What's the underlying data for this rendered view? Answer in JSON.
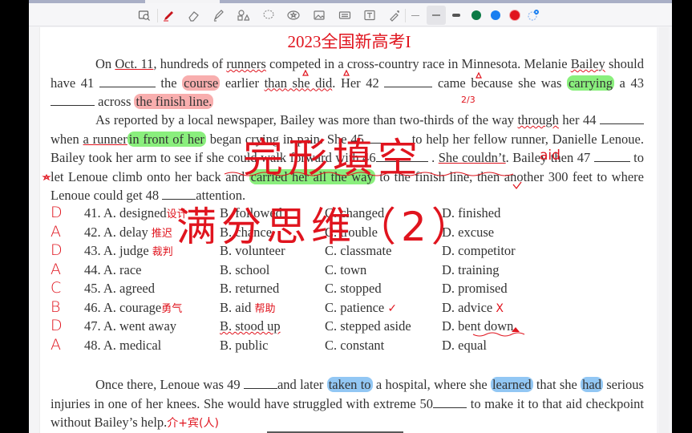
{
  "toolbar": {
    "tools": [
      {
        "name": "screen-capture-icon"
      },
      {
        "name": "pen-icon"
      },
      {
        "name": "eraser-icon"
      },
      {
        "name": "highlighter-icon"
      },
      {
        "name": "shapes-icon"
      },
      {
        "name": "lasso-icon"
      },
      {
        "name": "sticker-icon"
      },
      {
        "name": "image-icon"
      },
      {
        "name": "keyboard-icon"
      },
      {
        "name": "text-box-icon"
      },
      {
        "name": "laser-pointer-icon"
      }
    ],
    "stroke_widths": [
      "thin",
      "medium",
      "thick"
    ],
    "selected_stroke": "medium",
    "colors": [
      "#0b7a45",
      "#1a7ff0",
      "#e0141e"
    ],
    "selected_color": "#e0141e",
    "badge": "9"
  },
  "document": {
    "title": "2023全国新高考I",
    "overlay_title_1": "完形填空",
    "overlay_title_2": "满分思维（2）",
    "paragraph1": {
      "s1": "On ",
      "oct": "Oct. 11",
      "s2": ", hundreds of ",
      "runners": "runners",
      "s3": " competed in a cross-country race in Minnesota. Melanie ",
      "bailey": "Bailey",
      "s4": " should have 41 ",
      "s5": " the ",
      "course": "course",
      "s6": " earlier ",
      "than": "than she did",
      "s7": ". Her 42 ",
      "s8": " came because she was ",
      "carrying": "carrying",
      "s9": " a 43 ",
      "s10": " across ",
      "finish": "the finish line."
    },
    "paragraph2": {
      "s1": "As reported by a local newspaper, Bailey was more than two-thirds of the way ",
      "through": "through",
      "s2": " her 44 ",
      "s3": " when ",
      "runner": "a runner",
      "front": "in front of her",
      "s4": " began crying in pain. She 45",
      "s5": " to help her fellow runner, Danielle Lenoue. Bailey took her arm to see if she could walk forward with 46",
      "s6": " . ",
      "couldnt": "She couldn’t",
      "s7": ". Bailey then 47 ",
      "s8": " to let Lenoue climb onto her back and ",
      "carried": "carried her all the way",
      "s9": " to the finish line, then another 300 feet to where Lenoue could get 48 ",
      "s10": "attention."
    },
    "options": [
      {
        "answer": "D",
        "num": "41.",
        "a": "A. designed",
        "a_note": "设计",
        "b": "B. followed",
        "c": "C. changed",
        "d": "D. finished"
      },
      {
        "answer": "A",
        "num": "42.",
        "a": "A. delay",
        "a_note": "推迟",
        "b": "B. chance",
        "c": "C. trouble",
        "d": "D. excuse"
      },
      {
        "answer": "D",
        "num": "43.",
        "a": "A. judge",
        "a_note": "裁判",
        "b": "B. volunteer",
        "c": "C. classmate",
        "d": "D. competitor"
      },
      {
        "answer": "A",
        "num": "44.",
        "a": "A. race",
        "a_note": "",
        "b": "B. school",
        "c": "C. town",
        "d": "D. training"
      },
      {
        "answer": "C",
        "num": "45.",
        "a": "A. agreed",
        "a_note": "",
        "b": "B. returned",
        "c": "C. stopped",
        "d": "D. promised"
      },
      {
        "answer": "B",
        "num": "46.",
        "a": "A. courage",
        "a_note": "勇气",
        "b": "B. aid",
        "b_note": "帮助",
        "c": "C. patience",
        "d": "D. advice"
      },
      {
        "answer": "D",
        "num": "47.",
        "a": "A. went away",
        "a_note": "",
        "b": "B. stood up",
        "c": "C. stepped aside",
        "d": "D. bent down"
      },
      {
        "answer": "A",
        "num": "48.",
        "a": "A. medical",
        "a_note": "",
        "b": "B. public",
        "c": "C. constant",
        "d": "D. equal"
      }
    ],
    "paragraph3": {
      "s1": "Once there, Lenoue was 49 ",
      "s2": "and later ",
      "taken": "taken to",
      "s3": " a hospital, where she ",
      "learned": "learned",
      "s4": " that she ",
      "had": "had",
      "s5": " serious injuries in one of her knees. She would have struggled with extreme 50",
      "s6": " to make it to that aid checkpoint without Bailey’s help.",
      "note": "介+宾(人)"
    },
    "annotations": {
      "aid_note": "aid",
      "two_thirds": "2/3",
      "check": "✓",
      "cross": "X"
    }
  }
}
